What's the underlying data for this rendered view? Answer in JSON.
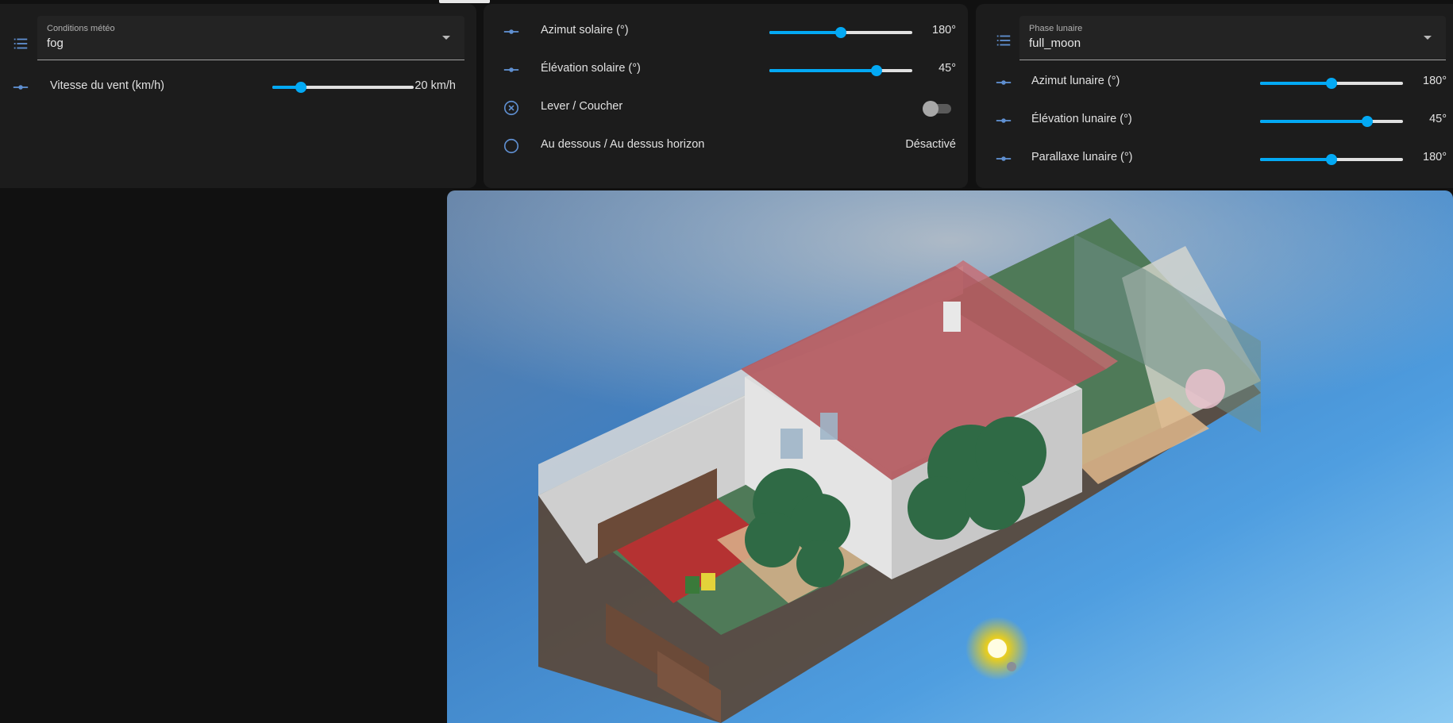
{
  "weather": {
    "select_label": "Conditions météo",
    "select_value": "fog",
    "wind_label": "Vitesse du vent (km/h)",
    "wind_value": "20 km/h",
    "wind_level_percent": 20
  },
  "sun": {
    "azimuth_label": "Azimut solaire (°)",
    "azimuth_value": "180°",
    "azimuth_level_percent": 50,
    "elevation_label": "Élévation solaire (°)",
    "elevation_value": "45°",
    "elevation_level_percent": 75,
    "rise_set_label": "Lever / Coucher",
    "rise_set_on": false,
    "horizon_label": "Au dessous / Au dessus horizon",
    "horizon_value": "Désactivé"
  },
  "moon": {
    "select_label": "Phase lunaire",
    "select_value": "full_moon",
    "azimuth_label": "Azimut lunaire (°)",
    "azimuth_value": "180°",
    "azimuth_level_percent": 50,
    "elevation_label": "Élévation lunaire (°)",
    "elevation_value": "45°",
    "elevation_level_percent": 75,
    "parallax_label": "Parallaxe lunaire (°)",
    "parallax_value": "180°",
    "parallax_level_percent": 50
  },
  "colors": {
    "accent": "#03a9f4",
    "icon": "#5f8fd0",
    "card": "#1c1c1c",
    "page": "#111111"
  },
  "icons": {
    "list": "format-list-bulleted-icon",
    "slider": "ray-vertex-icon",
    "cancel": "close-circle-outline-icon",
    "circle": "circle-outline-icon"
  }
}
